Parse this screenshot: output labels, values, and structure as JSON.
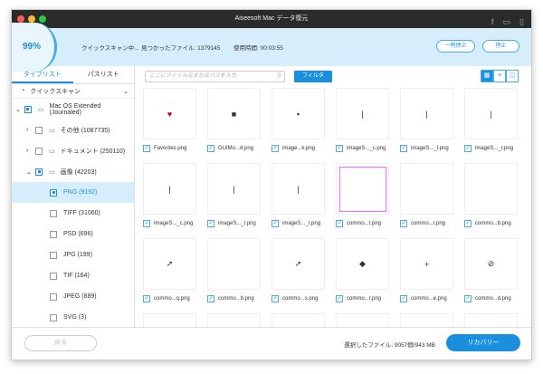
{
  "window": {
    "title": "Aiseesoft Mac データ復元",
    "colors": {
      "close": "#fc5f57",
      "min": "#fdbc2e",
      "max": "#29c940",
      "accent": "#1a8fe0"
    }
  },
  "scan": {
    "percent": "99%",
    "status": "クイックスキャン中...",
    "found": "見つかったファイル: 1379145",
    "elapsed": "使用時間: 00:03:55",
    "pause": "一時停止",
    "stop": "停止"
  },
  "sidebar": {
    "tabs": [
      "タイプリスト",
      "パスリスト"
    ],
    "mode": "クイックスキャン",
    "items": [
      {
        "label": "Mac OS Extended (Journaled)",
        "level": 0,
        "expand": "v",
        "checked": true,
        "icon": "drive-icon"
      },
      {
        "label": "その他 (1087735)",
        "level": 1,
        "expand": ">",
        "checked": false,
        "icon": "folder-icon"
      },
      {
        "label": "ドキュメント (250110)",
        "level": 1,
        "expand": ">",
        "checked": false,
        "icon": "document-icon"
      },
      {
        "label": "画像 (42203)",
        "level": 1,
        "expand": "v",
        "checked": true,
        "icon": "image-icon"
      },
      {
        "label": "PNG (9192)",
        "level": 2,
        "checked": true,
        "selected": true
      },
      {
        "label": "TIFF (31060)",
        "level": 2,
        "checked": false
      },
      {
        "label": "PSD (696)",
        "level": 2,
        "checked": false
      },
      {
        "label": "JPG (199)",
        "level": 2,
        "checked": false
      },
      {
        "label": "TIF (164)",
        "level": 2,
        "checked": false
      },
      {
        "label": "JPEG (889)",
        "level": 2,
        "checked": false
      },
      {
        "label": "SVG (3)",
        "level": 2,
        "checked": false
      }
    ]
  },
  "toolbar": {
    "search_placeholder": "ここにファイル名またはパスを入力",
    "filter": "フィルタ"
  },
  "files": [
    {
      "name": "Favorites.png",
      "glyph": "♥"
    },
    {
      "name": "GUIMo...d.png",
      "glyph": "■"
    },
    {
      "name": "image...k.png",
      "glyph": "▪"
    },
    {
      "name": "imageS..._c.png",
      "glyph": "|"
    },
    {
      "name": "imageS..._l.png",
      "glyph": "|"
    },
    {
      "name": "imageS..._r.png",
      "glyph": "|"
    },
    {
      "name": "imageS..._c.png",
      "glyph": "|"
    },
    {
      "name": "imageS..._l.png",
      "glyph": "|"
    },
    {
      "name": "imageS..._r.png",
      "glyph": "|"
    },
    {
      "name": "commo...t.png",
      "glyph": "pink"
    },
    {
      "name": "commo...r.png",
      "glyph": ""
    },
    {
      "name": "commo...b.png",
      "glyph": ""
    },
    {
      "name": "commo...q.png",
      "glyph": "➚"
    },
    {
      "name": "commo...b.png",
      "glyph": ""
    },
    {
      "name": "commo...s.png",
      "glyph": "➚"
    },
    {
      "name": "commo...r.png",
      "glyph": "◆"
    },
    {
      "name": "commo...e.png",
      "glyph": "+"
    },
    {
      "name": "commo...d.png",
      "glyph": "⊘"
    }
  ],
  "footer": {
    "back": "戻る",
    "selected": "選択したファイル: 9057個/943 MB",
    "recover": "リカバリー"
  }
}
